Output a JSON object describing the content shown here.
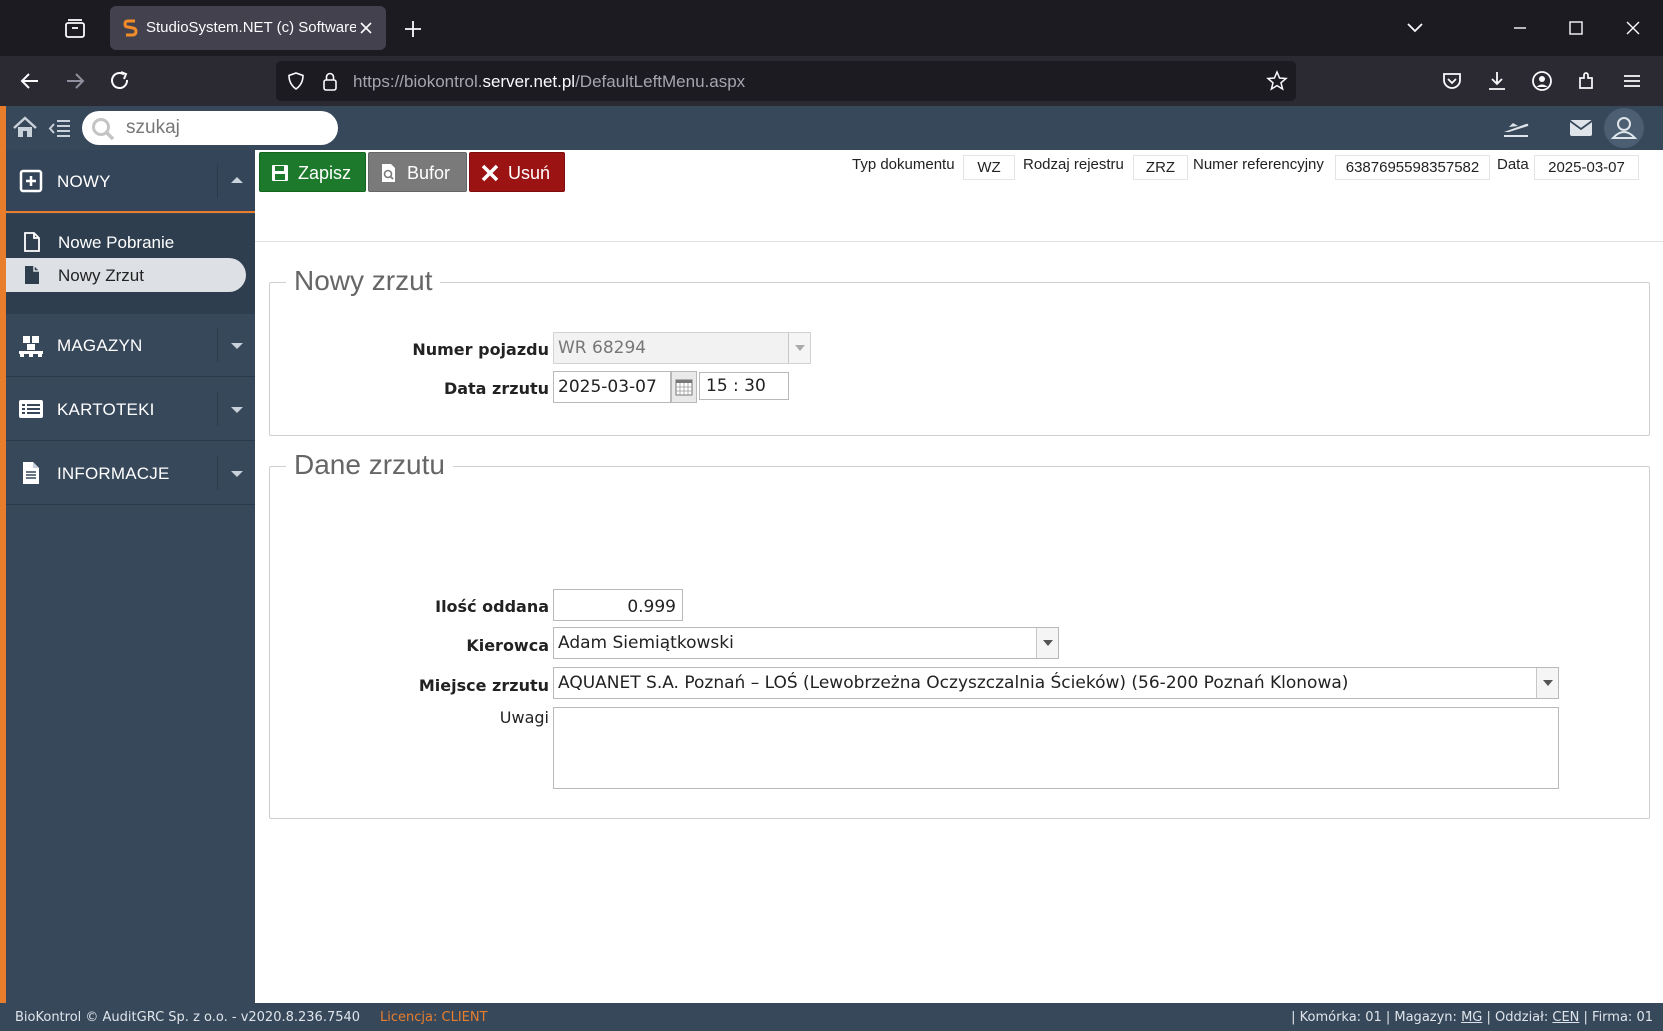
{
  "browser": {
    "tab_title": "StudioSystem.NET (c) SoftwareS",
    "url_prefix": "https://biokontrol.",
    "url_domain": "server.net.pl",
    "url_path": "/DefaultLeftMenu.aspx"
  },
  "topbar": {
    "search_placeholder": "szukaj"
  },
  "sidebar": {
    "sections": [
      {
        "label": "NOWY",
        "icon": "plus-square-icon",
        "expanded": true
      },
      {
        "label": "MAGAZYN",
        "icon": "pallet-icon",
        "expanded": false
      },
      {
        "label": "KARTOTEKI",
        "icon": "list-card-icon",
        "expanded": false
      },
      {
        "label": "INFORMACJE",
        "icon": "document-icon",
        "expanded": false
      }
    ],
    "submenu": [
      {
        "label": "Nowe Pobranie",
        "selected": false
      },
      {
        "label": "Nowy Zrzut",
        "selected": true
      }
    ]
  },
  "toolbar": {
    "save_label": "Zapisz",
    "buffer_label": "Bufor",
    "delete_label": "Usuń"
  },
  "document": {
    "type_label": "Typ dokumentu",
    "type_value": "WZ",
    "register_label": "Rodzaj rejestru",
    "register_value": "ZRZ",
    "ref_label": "Numer referencyjny",
    "ref_value": "6387695598357582",
    "date_label": "Data",
    "date_value": "2025-03-07"
  },
  "section_new": {
    "legend": "Nowy zrzut",
    "vehicle_label": "Numer pojazdu",
    "vehicle_value": "WR 68294",
    "date_label": "Data zrzutu",
    "date_value": "2025-03-07",
    "time_value": "15 : 30"
  },
  "section_data": {
    "legend": "Dane zrzutu",
    "qty_label": "Ilość oddana",
    "qty_value": "0.999",
    "driver_label": "Kierowca",
    "driver_value": "Adam Siemiątkowski",
    "place_label": "Miejsce zrzutu",
    "place_value": "AQUANET S.A. Poznań – LOŚ (Lewobrzeżna Oczyszczalnia Ścieków)  (56-200 Poznań Klonowa)",
    "notes_label": "Uwagi",
    "notes_value": ""
  },
  "status": {
    "left": "BioKontrol © AuditGRC Sp. z o.o. - v2020.8.236.7540",
    "license_label": "Licencja:",
    "license_value": "CLIENT",
    "cell_label": "| Komórka: 01 | Magazyn:",
    "warehouse": "MG",
    "branch_label": "| Oddział:",
    "branch": "CEN",
    "company": "| Firma: 01"
  },
  "colors": {
    "accent": "#e87e2c",
    "sidebar": "#37485a",
    "save": "#1d7a2c",
    "delete": "#9b1313"
  }
}
